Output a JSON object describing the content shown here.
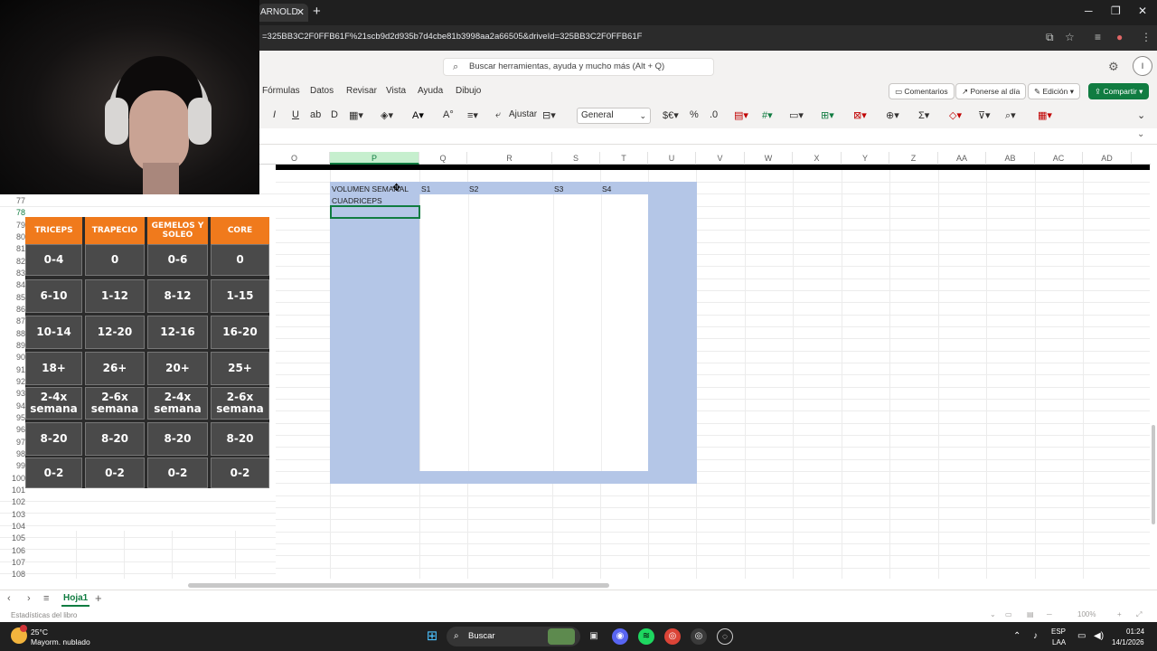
{
  "browser": {
    "tab_title": "ARNOLD",
    "tab_close": "✕",
    "new_tab": "+",
    "window_minimize": "─",
    "window_maximize": "❐",
    "window_close": "✕",
    "url": "=325BB3C2F0FFB61F%21scb9d2d935b7d4cbe81b3998aa2a66505&driveId=325BB3C2F0FFB61F"
  },
  "excel": {
    "search_placeholder": "Buscar herramientas, ayuda y mucho más (Alt + Q)",
    "avatar_initial": "I",
    "menu": [
      "Fórmulas",
      "Datos",
      "Revisar",
      "Vista",
      "Ayuda",
      "Dibujo"
    ],
    "comments_label": "Comentarios",
    "catchup_label": "Ponerse al día",
    "edit_mode_label": "Edición",
    "share_label": "Compartir",
    "wrap_label": "Ajustar",
    "number_format": "General"
  },
  "grid": {
    "columns": [
      "O",
      "P",
      "Q",
      "R",
      "S",
      "T",
      "U",
      "V",
      "W",
      "X",
      "Y",
      "Z",
      "AA",
      "AB",
      "AC",
      "AD"
    ],
    "selected_column": "P",
    "rows": [
      "77",
      "78",
      "79",
      "80",
      "81",
      "82",
      "83",
      "84",
      "85",
      "86",
      "87",
      "88",
      "89",
      "90",
      "91",
      "92",
      "93",
      "94",
      "95",
      "96",
      "97",
      "98",
      "99",
      "100",
      "101",
      "102",
      "103",
      "104",
      "105",
      "106",
      "107",
      "108"
    ],
    "selected_row": "78",
    "cells": {
      "p76": "VOLUMEN SEMANAL",
      "p77": "CUADRICEPS",
      "q76": "S1",
      "r76": "S2",
      "s76": "S3",
      "t76": "S4"
    }
  },
  "overlay_table": {
    "headers": [
      "TRICEPS",
      "TRAPECIO",
      "GEMELOS Y SOLEO",
      "CORE"
    ],
    "rows": [
      [
        "0-4",
        "0",
        "0-6",
        "0"
      ],
      [
        "6-10",
        "1-12",
        "8-12",
        "1-15"
      ],
      [
        "10-14",
        "12-20",
        "12-16",
        "16-20"
      ],
      [
        "18+",
        "26+",
        "20+",
        "25+"
      ],
      [
        "2-4x semana",
        "2-6x semana",
        "2-4x semana",
        "2-6x semana"
      ],
      [
        "8-20",
        "8-20",
        "8-20",
        "8-20"
      ],
      [
        "0-2",
        "0-2",
        "0-2",
        "0-2"
      ]
    ],
    "colors": {
      "header": "#f07a1c",
      "cell": "#4a4a4a"
    }
  },
  "sheet": {
    "tab_name": "Hoja1",
    "add_sheet": "+",
    "status_left": "Estadísticas del libro",
    "zoom": "100%"
  },
  "taskbar": {
    "temperature": "25°C",
    "weather": "Mayorm. nublado",
    "search_label": "Buscar",
    "lang_top": "ESP",
    "lang_bottom": "LAA",
    "time": "01:24",
    "date": "14/1/2026"
  },
  "colors": {
    "excel_green": "#107c41",
    "selection_blue": "#b4c6e7"
  }
}
